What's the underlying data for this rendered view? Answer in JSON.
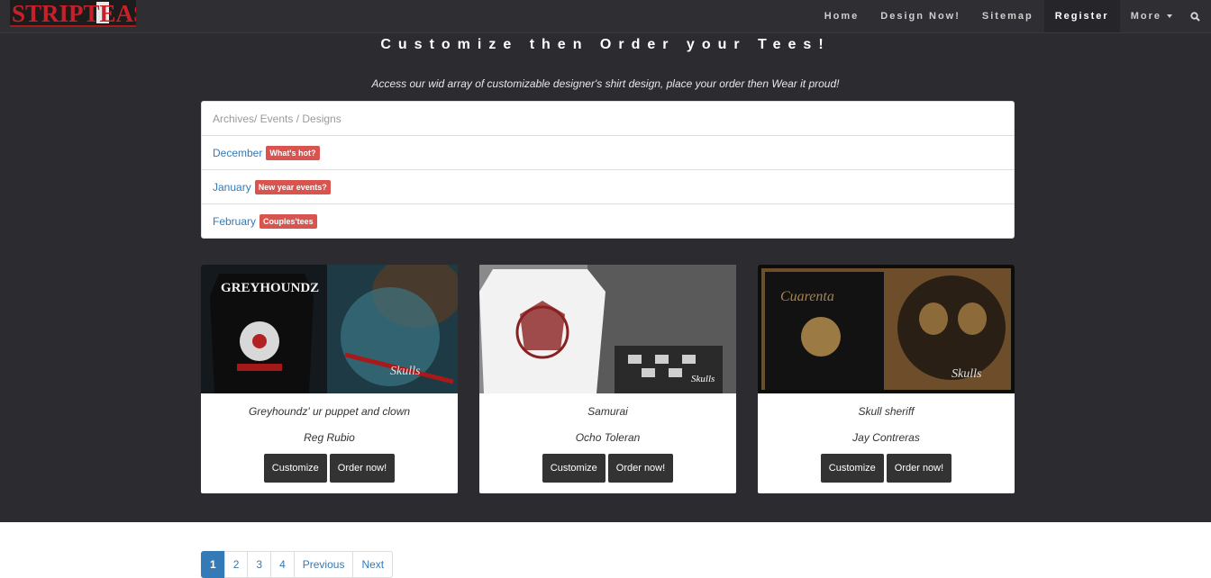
{
  "brand": {
    "logo_text": "STRIPTEAS"
  },
  "nav": {
    "items": [
      "Home",
      "Design Now!",
      "Sitemap",
      "Register",
      "More"
    ],
    "active": "Register",
    "search_icon": "search-icon"
  },
  "hero": {
    "title": "Customize then Order your Tees!",
    "subtitle": "Access our wid array of customizable designer's shirt design, place your order then Wear it proud!"
  },
  "archive": {
    "header": "Archives/ Events / Designs",
    "items": [
      {
        "month": "December",
        "badge": "What's hot?"
      },
      {
        "month": "January",
        "badge": "New year events?"
      },
      {
        "month": "February",
        "badge": "Couples'tees"
      }
    ]
  },
  "cards": [
    {
      "title": "Greyhoundz' ur puppet and clown",
      "author": "Reg Rubio",
      "customize": "Customize",
      "order": "Order now!"
    },
    {
      "title": "Samurai",
      "author": "Ocho Toleran",
      "customize": "Customize",
      "order": "Order now!"
    },
    {
      "title": "Skull sheriff",
      "author": "Jay Contreras",
      "customize": "Customize",
      "order": "Order now!"
    }
  ],
  "pagination": {
    "pages": [
      "1",
      "2",
      "3",
      "4"
    ],
    "current": "1",
    "previous": "Previous",
    "next": "Next"
  },
  "colors": {
    "band": "#2c2c30",
    "link": "#337ab7",
    "badge": "#d9534f",
    "button": "#333333"
  }
}
